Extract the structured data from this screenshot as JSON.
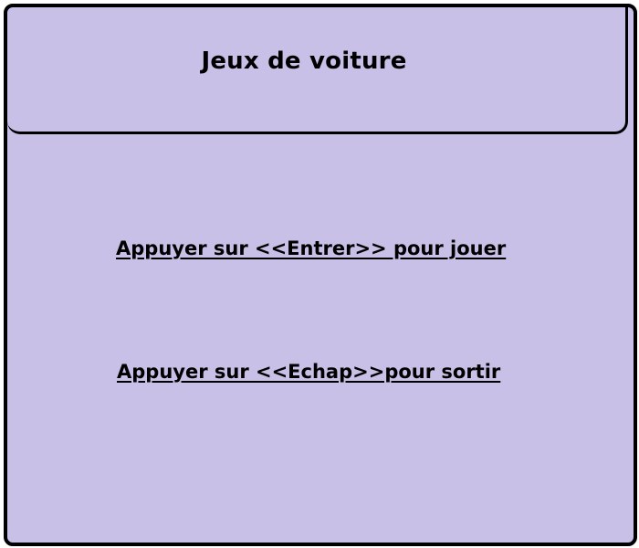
{
  "window": {
    "title": "Jeux de voiture"
  },
  "menu": {
    "play_label": "Appuyer sur <<Entrer>> pour jouer",
    "quit_label": "Appuyer sur <<Echap>>pour sortir"
  },
  "colors": {
    "background": "#c8c0e6",
    "border": "#000000",
    "text": "#000000"
  }
}
